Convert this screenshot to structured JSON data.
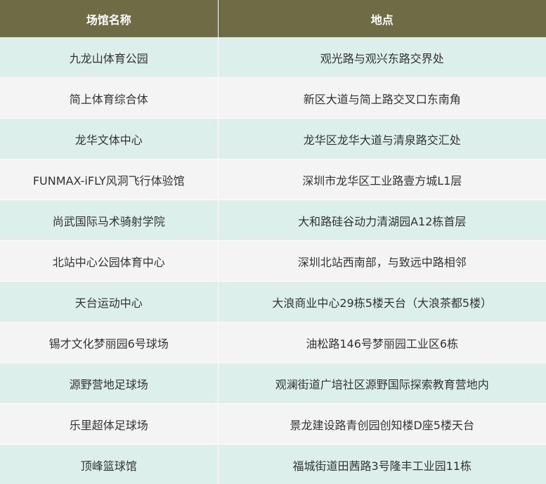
{
  "header": {
    "col_name": "场馆名称",
    "col_location": "地点"
  },
  "colors": {
    "header_bg": "#6e6b45",
    "row_odd_bg": "#dcefeb",
    "row_even_bg": "#f4f4f4"
  },
  "rows": [
    {
      "name": "九龙山体育公园",
      "location": "观光路与观兴东路交界处"
    },
    {
      "name": "简上体育综合体",
      "location": "新区大道与简上路交叉口东南角"
    },
    {
      "name": "龙华文体中心",
      "location": "龙华区龙华大道与清泉路交汇处"
    },
    {
      "name": "FUNMAX-iFLY风洞飞行体验馆",
      "location": "深圳市龙华区工业路壹方城L1层"
    },
    {
      "name": "尚武国际马术骑射学院",
      "location": "大和路硅谷动力清湖园A12栋首层"
    },
    {
      "name": "北站中心公园体育中心",
      "location": "深圳北站西南部，与致远中路相邻"
    },
    {
      "name": "天台运动中心",
      "location": "大浪商业中心29栋5楼天台（大浪茶都5楼）"
    },
    {
      "name": "锡才文化梦丽园6号球场",
      "location": "油松路146号梦丽园工业区6栋"
    },
    {
      "name": "源野营地足球场",
      "location": "观澜街道广培社区源野国际探索教育营地内"
    },
    {
      "name": "乐里超体足球场",
      "location": "景龙建设路青创园创知楼D座5楼天台"
    },
    {
      "name": "顶峰篮球馆",
      "location": "福城街道田茜路3号隆丰工业园11栋"
    }
  ]
}
